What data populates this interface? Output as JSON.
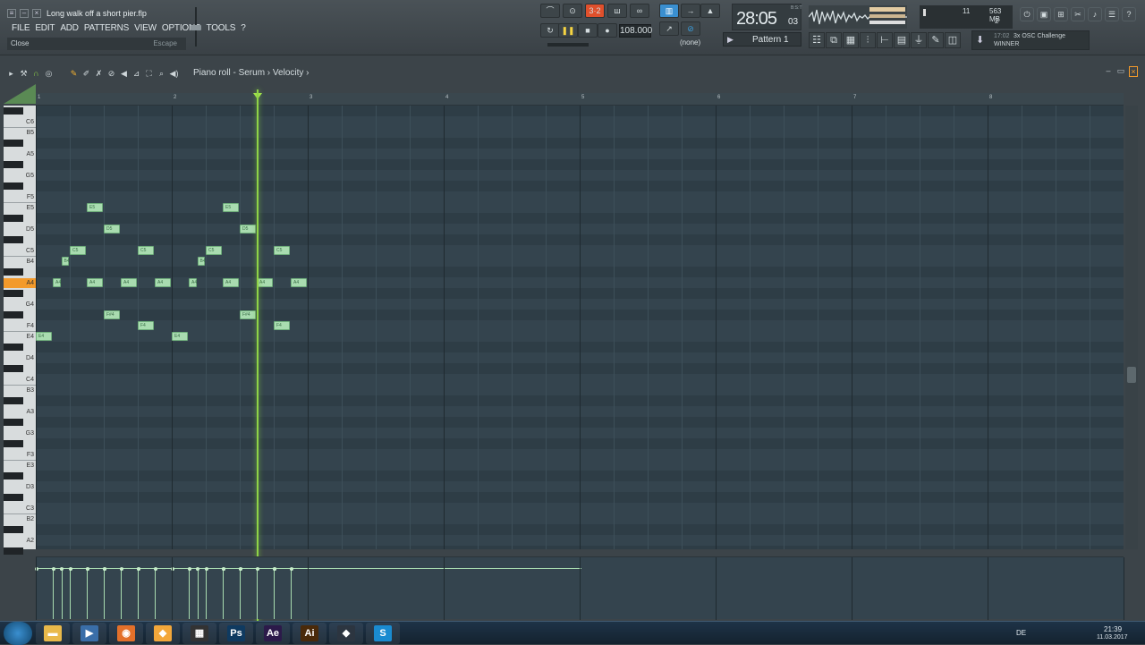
{
  "window": {
    "file_title": "Long walk off a short pier.flp",
    "menu": [
      "FILE",
      "EDIT",
      "ADD",
      "PATTERNS",
      "VIEW",
      "OPTIONS",
      "TOOLS",
      "?"
    ],
    "hint_left": "Close",
    "hint_right": "Escape"
  },
  "transport": {
    "bpm": "108.000",
    "time_main": "28:05",
    "time_small": "03",
    "bst": "B:S:T",
    "snap": "(none)",
    "pattern": "Pattern 1",
    "cpu_a": "11",
    "cpu_b": "563 MB",
    "cpu_c": "2"
  },
  "news": {
    "time": "17:02",
    "title": "3x OSC Challenge",
    "sub": "WINNER"
  },
  "piano_roll": {
    "title": "Piano roll - Serum › Velocity ›",
    "ruler": [
      "1",
      "2",
      "3",
      "4",
      "5",
      "6",
      "7",
      "8"
    ],
    "keys": [
      "C6",
      "B5",
      "A5",
      "G5",
      "F5",
      "E5",
      "D5",
      "C5",
      "B4",
      "A4",
      "G4",
      "F4",
      "E4",
      "D4",
      "C4",
      "B3",
      "A3",
      "G3",
      "F3",
      "E3",
      "D3",
      "C3",
      "B2",
      "A2"
    ],
    "active_key": "A4",
    "notes": [
      {
        "label": "E4",
        "pitch": "E4",
        "start": 0.0,
        "len": 0.5
      },
      {
        "label": "A4",
        "pitch": "A4",
        "start": 0.5,
        "len": 0.25
      },
      {
        "label": "B4",
        "pitch": "B4",
        "start": 0.75,
        "len": 0.25
      },
      {
        "label": "C5",
        "pitch": "C5",
        "start": 1.0,
        "len": 0.5
      },
      {
        "label": "A4",
        "pitch": "A4",
        "start": 1.5,
        "len": 0.5
      },
      {
        "label": "E5",
        "pitch": "E5",
        "start": 1.5,
        "len": 0.5
      },
      {
        "label": "D5",
        "pitch": "D5",
        "start": 2.0,
        "len": 0.5
      },
      {
        "label": "F#4",
        "pitch": "F#4",
        "start": 2.0,
        "len": 0.5
      },
      {
        "label": "A4",
        "pitch": "A4",
        "start": 2.5,
        "len": 0.5
      },
      {
        "label": "C5",
        "pitch": "C5",
        "start": 3.0,
        "len": 0.5
      },
      {
        "label": "F4",
        "pitch": "F4",
        "start": 3.0,
        "len": 0.5
      },
      {
        "label": "A4",
        "pitch": "A4",
        "start": 3.5,
        "len": 0.5
      },
      {
        "label": "E4",
        "pitch": "E4",
        "start": 4.0,
        "len": 0.5
      },
      {
        "label": "A4",
        "pitch": "A4",
        "start": 4.5,
        "len": 0.25
      },
      {
        "label": "B4",
        "pitch": "B4",
        "start": 4.75,
        "len": 0.25
      },
      {
        "label": "C5",
        "pitch": "C5",
        "start": 5.0,
        "len": 0.5
      },
      {
        "label": "A4",
        "pitch": "A4",
        "start": 5.5,
        "len": 0.5
      },
      {
        "label": "E5",
        "pitch": "E5",
        "start": 5.5,
        "len": 0.5
      },
      {
        "label": "D5",
        "pitch": "D5",
        "start": 6.0,
        "len": 0.5
      },
      {
        "label": "F#4",
        "pitch": "F#4",
        "start": 6.0,
        "len": 0.5
      },
      {
        "label": "A4",
        "pitch": "A4",
        "start": 6.5,
        "len": 0.5
      },
      {
        "label": "C5",
        "pitch": "C5",
        "start": 7.0,
        "len": 0.5
      },
      {
        "label": "F4",
        "pitch": "F4",
        "start": 7.0,
        "len": 0.5
      },
      {
        "label": "A4",
        "pitch": "A4",
        "start": 7.5,
        "len": 0.5
      }
    ],
    "playhead_beat": 6.5
  },
  "taskbar": {
    "apps": [
      "explorer-icon",
      "media-icon",
      "firefox-icon",
      "fl-studio-icon",
      "film-icon",
      "photoshop-icon",
      "after-effects-icon",
      "illustrator-icon",
      "cinema4d-icon",
      "skype-icon"
    ],
    "labels": [
      "",
      "",
      "",
      "",
      "",
      "Ps",
      "Ae",
      "Ai",
      "",
      "S"
    ],
    "lang": "DE",
    "time": "21:39",
    "date": "11.03.2017"
  },
  "colors": {
    "note": "#a9dcb0",
    "playhead": "#8fd447",
    "active_key": "#f39a2b",
    "grid_bg": "#34444e"
  }
}
